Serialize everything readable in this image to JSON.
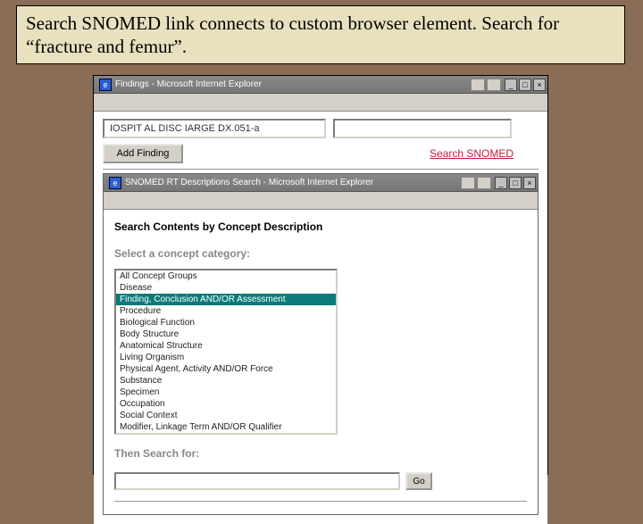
{
  "caption": "Search SNOMED link connects to custom browser element. Search for “fracture and femur”.",
  "outer": {
    "title": "Findings - Microsoft Internet Explorer",
    "dx_value": "IOSPIT AL DISC IARGE DX.051-a",
    "add_finding": "Add Finding",
    "search_snomed": "Search SNOMED"
  },
  "inner": {
    "title": "SNOMED RT Descriptions Search - Microsoft Internet Explorer",
    "search_by_prefix": "Search Contents by ",
    "search_by_concept": "Concept Description",
    "select_category": "Select a concept category:",
    "then_search": "Then Search for:",
    "go": "Go",
    "categories": [
      "All Concept Groups",
      "Disease",
      "Finding, Conclusion AND/OR Assessment",
      "Procedure",
      "Biological Function",
      "Body Structure",
      "Anatomical Structure",
      "Living Organism",
      "Physical Agent, Activity AND/OR Force",
      "Substance",
      "Specimen",
      "Occupation",
      "Social Context",
      "Modifier, Linkage Term AND/OR Qualifier"
    ],
    "selected_index": 2
  }
}
